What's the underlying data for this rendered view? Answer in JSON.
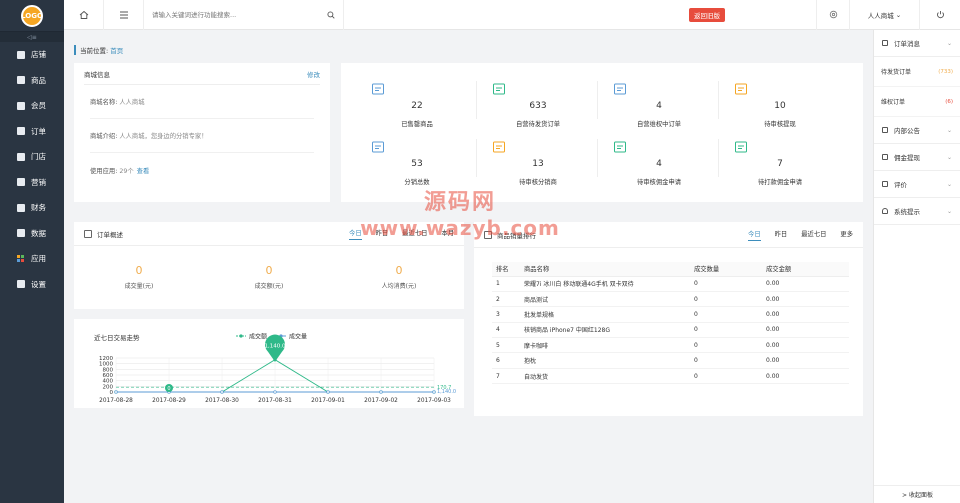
{
  "logo_text": "LOGO",
  "sidebar": {
    "collapse_label": "◁≡",
    "items": [
      {
        "label": "店铺",
        "icon": "store-icon"
      },
      {
        "label": "商品",
        "icon": "goods-icon"
      },
      {
        "label": "会员",
        "icon": "member-icon"
      },
      {
        "label": "订单",
        "icon": "order-icon"
      },
      {
        "label": "门店",
        "icon": "shop-icon"
      },
      {
        "label": "营销",
        "icon": "marketing-icon"
      },
      {
        "label": "财务",
        "icon": "finance-icon"
      },
      {
        "label": "数据",
        "icon": "data-icon"
      },
      {
        "label": "应用",
        "icon": "apps-icon"
      },
      {
        "label": "设置",
        "icon": "settings-icon"
      }
    ]
  },
  "topbar": {
    "search_placeholder": "请输入关键词进行功能搜索...",
    "back_old_label": "返回旧版",
    "user_name": "人人商城",
    "user_caret": "⌄"
  },
  "breadcrumb": {
    "prefix": "当前位置:",
    "current": "首页"
  },
  "shop_info": {
    "title": "商城信息",
    "edit_label": "修改",
    "name_label": "商城名称:",
    "name_value": "人人商城",
    "intro_label": "商城介绍:",
    "intro_value": "人人商城，您身边的分销专家！",
    "apps_label": "使用应用:",
    "apps_value": "29个",
    "apps_link": "查看"
  },
  "stats": [
    {
      "value": "22",
      "label": "已售罄商品",
      "icon": "sold-out-icon"
    },
    {
      "value": "633",
      "label": "自营待发货订单",
      "icon": "delivery-icon"
    },
    {
      "value": "4",
      "label": "自营维权中订单",
      "icon": "rights-icon"
    },
    {
      "value": "10",
      "label": "待审核提现",
      "icon": "withdraw-icon"
    },
    {
      "value": "53",
      "label": "分销总数",
      "icon": "distributors-icon"
    },
    {
      "value": "13",
      "label": "待审核分销商",
      "icon": "pending-distributor-icon"
    },
    {
      "value": "4",
      "label": "待审核佣金申请",
      "icon": "commission-apply-icon"
    },
    {
      "value": "7",
      "label": "待打款佣金申请",
      "icon": "commission-pay-icon"
    }
  ],
  "order_overview": {
    "title": "订单概述",
    "tabs": [
      "今日",
      "昨日",
      "最近七日",
      "本月"
    ],
    "items": [
      {
        "value": "0",
        "label": "成交量(元)"
      },
      {
        "value": "0",
        "label": "成交额(元)"
      },
      {
        "value": "0",
        "label": "人均消费(元)"
      }
    ]
  },
  "trend": {
    "title": "近七日交易走势",
    "badge": "1,140.0",
    "marker_low": "0",
    "label_right_1": "1,140.0",
    "label_right_2": "170.7"
  },
  "chart_data": {
    "type": "line",
    "title": "近七日交易走势",
    "x": [
      "2017-08-28",
      "2017-08-29",
      "2017-08-30",
      "2017-08-31",
      "2017-09-01",
      "2017-09-02",
      "2017-09-03"
    ],
    "ylim": [
      0,
      1200
    ],
    "yticks": [
      "1200",
      "1000",
      "800",
      "600",
      "400",
      "200",
      "0"
    ],
    "series": [
      {
        "name": "成交额",
        "values": [
          0,
          0,
          0,
          1140.0,
          0,
          0,
          0
        ],
        "color": "#2fb989"
      },
      {
        "name": "成交量",
        "values": [
          0,
          0,
          0,
          0,
          0,
          0,
          0
        ],
        "color": "#5b9bd5"
      }
    ]
  },
  "ranking": {
    "title": "商品销量排行",
    "tabs": [
      "今日",
      "昨日",
      "最近七日",
      "更多"
    ],
    "columns": [
      "排名",
      "商品名称",
      "成交数量",
      "成交金额"
    ],
    "rows": [
      {
        "rank": "1",
        "name": "荣耀7i 冰川白 移动联通4G手机 双卡双待",
        "qty": "0",
        "amt": "0.00"
      },
      {
        "rank": "2",
        "name": "商品测试",
        "qty": "0",
        "amt": "0.00"
      },
      {
        "rank": "3",
        "name": "批发单规格",
        "qty": "0",
        "amt": "0.00"
      },
      {
        "rank": "4",
        "name": "核销商品 iPhone7 中国红128G",
        "qty": "0",
        "amt": "0.00"
      },
      {
        "rank": "5",
        "name": "摩卡咖啡",
        "qty": "0",
        "amt": "0.00"
      },
      {
        "rank": "6",
        "name": "抱枕",
        "qty": "0",
        "amt": "0.00"
      },
      {
        "rank": "7",
        "name": "自动发货",
        "qty": "0",
        "amt": "0.00"
      }
    ]
  },
  "right_panel": {
    "order_msg": "订单消息",
    "pending_ship": "待发货订单",
    "pending_ship_count": "(733)",
    "rights_order": "维权订单",
    "rights_count": "(6)",
    "notice": "内部公告",
    "commission": "佣金提现",
    "review": "评价",
    "system": "系统提示",
    "collapse": "> 收起面板"
  },
  "watermark": {
    "line1": "源码网",
    "line2": "www.wazyb.com"
  },
  "colors": {
    "accent": "#3c8dbc",
    "sidebar": "#2a3542",
    "orange": "#f0ad4e",
    "red": "#e74c3c",
    "green": "#2fb989"
  }
}
